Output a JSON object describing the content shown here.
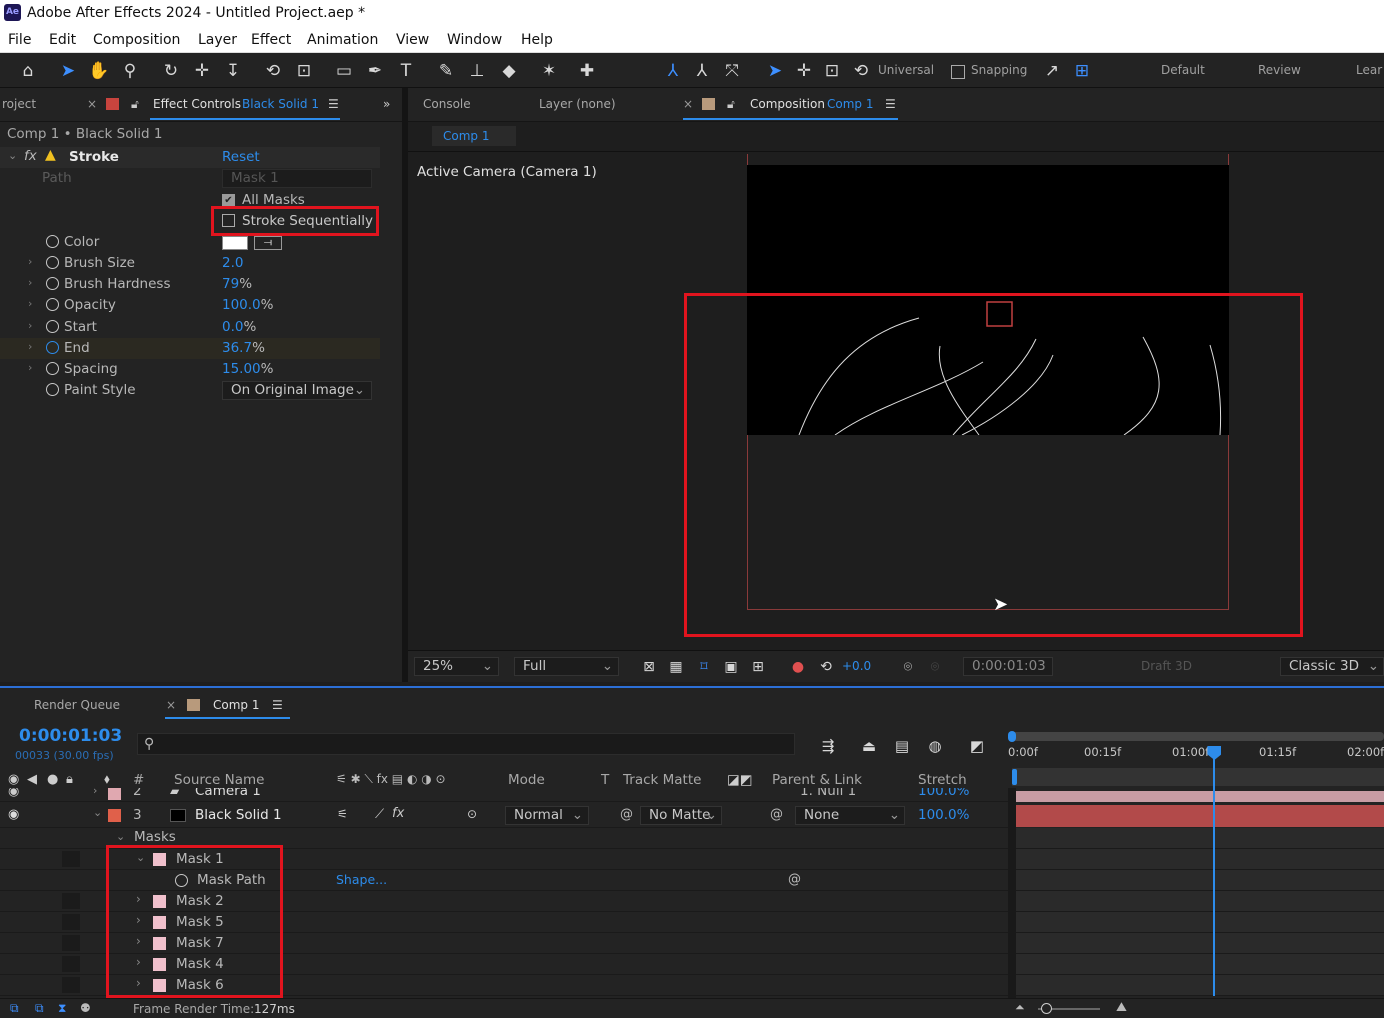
{
  "window": {
    "logo": "Ae",
    "title": "Adobe After Effects 2024 - Untitled Project.aep *"
  },
  "menu": [
    "File",
    "Edit",
    "Composition",
    "Layer",
    "Effect",
    "Animation",
    "View",
    "Window",
    "Help"
  ],
  "toolbar": {
    "universal": "Universal",
    "snapping": "Snapping",
    "workspaces": [
      "Default",
      "Review",
      "Lear"
    ]
  },
  "effect_panel": {
    "project_tab": "roject",
    "tab_label": "Effect Controls",
    "tab_layer": "Black Solid 1",
    "breadcrumb": "Comp 1 • Black Solid 1",
    "effect_name": "Stroke",
    "reset": "Reset",
    "path_label": "Path",
    "path_value": "Mask 1",
    "all_masks": "All Masks",
    "stroke_seq": "Stroke Sequentially",
    "props": [
      {
        "label": "Color",
        "value": "",
        "unit": ""
      },
      {
        "label": "Brush Size",
        "value": "2.0",
        "unit": ""
      },
      {
        "label": "Brush Hardness",
        "value": "79",
        "unit": "%"
      },
      {
        "label": "Opacity",
        "value": "100.0",
        "unit": "%"
      },
      {
        "label": "Start",
        "value": "0.0",
        "unit": "%"
      },
      {
        "label": "End",
        "value": "36.7",
        "unit": "%"
      },
      {
        "label": "Spacing",
        "value": "15.00",
        "unit": "%"
      }
    ],
    "paint_style_label": "Paint Style",
    "paint_style_value": "On Original Image"
  },
  "viewer": {
    "tabs": [
      "Console",
      "Layer (none)"
    ],
    "comp_tab_label": "Composition",
    "comp_tab_name": "Comp 1",
    "subtab": "Comp 1",
    "camera_label": "Active Camera (Camera 1)",
    "footer": {
      "zoom": "25%",
      "quality": "Full",
      "exposure": "+0.0",
      "timecode": "0:00:01:03",
      "draft": "Draft 3D",
      "renderer": "Classic 3D"
    }
  },
  "timeline": {
    "render_queue": "Render Queue",
    "comp_tab": "Comp 1",
    "timecode": "0:00:01:03",
    "frame_info": "00033 (30.00 fps)",
    "columns": {
      "hash": "#",
      "source": "Source Name",
      "mode": "Mode",
      "t": "T",
      "track_matte": "Track Matte",
      "parent": "Parent & Link",
      "stretch": "Stretch"
    },
    "layers": [
      {
        "num": "2",
        "name": "Camera 1",
        "parent": "1. Null 1",
        "stretch": "100.0%"
      },
      {
        "num": "3",
        "name": "Black Solid 1",
        "mode": "Normal",
        "matte": "No Matte",
        "parent": "None",
        "stretch": "100.0%"
      }
    ],
    "masks_label": "Masks",
    "mask_path": "Mask Path",
    "shape_link": "Shape...",
    "masks": [
      "Mask 1",
      "Mask 2",
      "Mask 5",
      "Mask 7",
      "Mask 4",
      "Mask 6"
    ],
    "ruler": [
      "0:00f",
      "00:15f",
      "01:00f",
      "01:15f",
      "02:00f"
    ],
    "playhead_fraction": 0.55,
    "status": "Frame Render Time:",
    "render_time": "127ms"
  },
  "colors": {
    "accent": "#2d8ceb",
    "highlight": "#e1141e",
    "solid_layer": "#b24a4a"
  }
}
